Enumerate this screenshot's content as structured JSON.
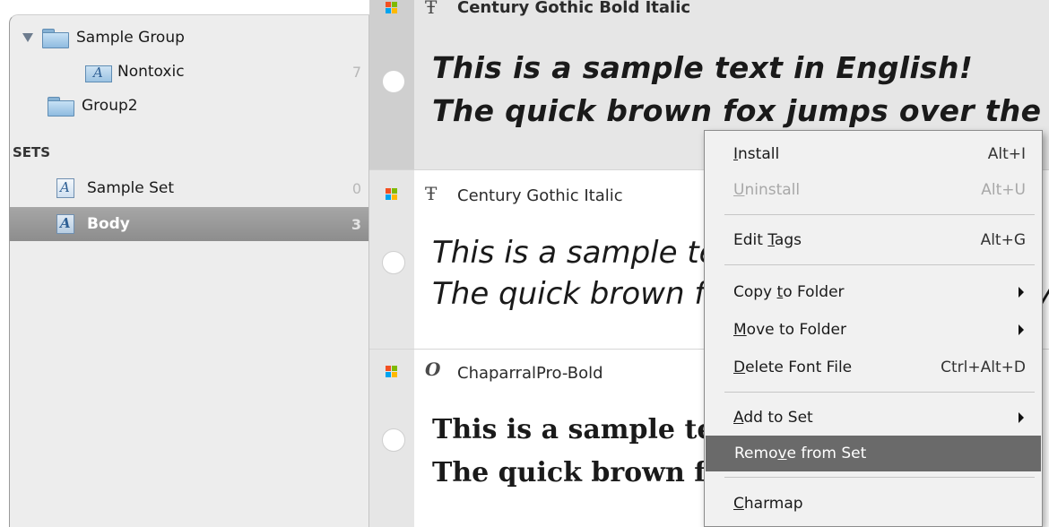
{
  "sidebar": {
    "groups": [
      {
        "name": "Sample Group",
        "expanded": true
      },
      {
        "name": "Nontoxic",
        "count": "7"
      },
      {
        "name": "Group2"
      }
    ],
    "sets_header": "SETS",
    "sets": [
      {
        "name": "Sample Set",
        "count": "0"
      },
      {
        "name": "Body",
        "count": "3",
        "selected": true
      }
    ]
  },
  "fonts": [
    {
      "name": "Century Gothic Bold Italic",
      "type_icon": "truetype-icon",
      "sample_line1": "This is a sample text in English!",
      "sample_line2": "The quick brown fox jumps over the lazy dog",
      "selected": true
    },
    {
      "name": "Century Gothic Italic",
      "type_icon": "truetype-icon",
      "sample_line1": "This is a sample text in English!",
      "sample_line2": "The quick brown fox jumps over the lazy dog"
    },
    {
      "name": "ChaparralPro-Bold",
      "type_icon": "opentype-icon",
      "sample_line1": "This is a sample text in English!",
      "sample_line2": "The quick brown fox jumps over the lazy dog"
    }
  ],
  "context_menu": {
    "install": {
      "pre": "",
      "key": "I",
      "post": "nstall",
      "shortcut": "Alt+I"
    },
    "uninstall": {
      "pre": "",
      "key": "U",
      "post": "ninstall",
      "shortcut": "Alt+U"
    },
    "edit_tags": {
      "pre": "Edit ",
      "key": "T",
      "post": "ags",
      "shortcut": "Alt+G"
    },
    "copy_to_folder": {
      "pre": "Copy ",
      "key": "t",
      "post": "o Folder"
    },
    "move_to_folder": {
      "pre": "",
      "key": "M",
      "post": "ove to Folder"
    },
    "delete_font_file": {
      "pre": "",
      "key": "D",
      "post": "elete Font File",
      "shortcut": "Ctrl+Alt+D"
    },
    "add_to_set": {
      "pre": "",
      "key": "A",
      "post": "dd to Set"
    },
    "remove_from_set": {
      "pre": "Remo",
      "key": "v",
      "post": "e from Set"
    },
    "charmap": {
      "pre": "",
      "key": "C",
      "post": "harmap"
    }
  },
  "colors": {
    "windows_flag": [
      "#f25022",
      "#7fba00",
      "#00a4ef",
      "#ffb900"
    ],
    "menu_highlight": "#6a6a6a",
    "selection": "#9a9a9a"
  }
}
